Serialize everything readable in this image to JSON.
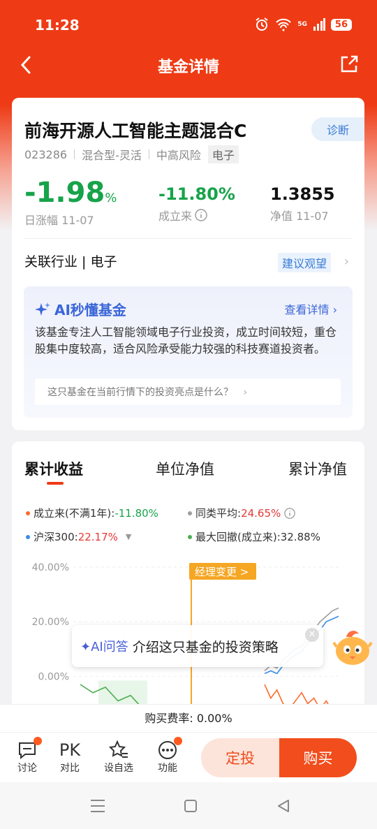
{
  "status": {
    "time": "11:28",
    "network": "5G",
    "battery": "56"
  },
  "nav": {
    "title": "基金详情"
  },
  "fund": {
    "name": "前海开源人工智能主题混合C",
    "diagnose": "诊断",
    "code": "023286",
    "type": "混合型-灵活",
    "risk": "中高风险",
    "sector_tag": "电子",
    "daily_change": "-1.98",
    "daily_change_unit": "%",
    "daily_label": "日涨幅 11-07",
    "since_inception": "-11.80%",
    "since_label": "成立来",
    "nav_value": "1.3855",
    "nav_label": "净值 11-07",
    "industry": "关联行业 | 电子",
    "suggestion": "建议观望"
  },
  "ai": {
    "title": "AI秒懂基金",
    "more": "查看详情 ›",
    "text": "该基金专注人工智能领域电子行业投资，成立时间较短，重仓股集中度较高，适合风险承受能力较强的科技赛道投资者。",
    "question": "这只基金在当前行情下的投资亮点是什么？"
  },
  "tabs": [
    "累计收益",
    "单位净值",
    "累计净值"
  ],
  "legend": {
    "l1_label": "成立来(不满1年):",
    "l1_value": "-11.80%",
    "l2_label": "同类平均:",
    "l2_value": "24.65%",
    "l3_label": "沪深300:",
    "l3_value": "22.17%",
    "l4_label": "最大回撤(成立来):",
    "l4_value": "32.88%"
  },
  "chart_data": {
    "type": "line",
    "y_ticks": [
      "40.00%",
      "20.00%",
      "0.00%"
    ],
    "ylim": [
      -15,
      40
    ],
    "marker_label": "经理变更 >",
    "series": [
      {
        "name": "同类平均",
        "color": "#9e9e9e",
        "values": [
          2,
          4,
          3,
          6,
          8,
          10,
          11,
          14,
          17,
          20,
          22,
          24,
          25
        ]
      },
      {
        "name": "沪深300",
        "color": "#3a8ee6",
        "values": [
          1,
          2,
          1,
          4,
          6,
          8,
          9,
          12,
          15,
          17,
          20,
          21,
          22
        ]
      },
      {
        "name": "成立来",
        "color": "#ff6a2b",
        "values": [
          -3,
          -8,
          -5,
          -10,
          -12,
          -9,
          -6,
          -10,
          -8,
          -12,
          -9,
          -13,
          -12
        ]
      }
    ]
  },
  "float_prompt": {
    "label": "✦AI问答",
    "text": "介绍这只基金的投资策略"
  },
  "fee": "购买费率: 0.00%",
  "toolbar": {
    "discuss": "讨论",
    "compare_icon": "PK",
    "compare": "对比",
    "watch": "设自选",
    "func": "功能",
    "sip": "定投",
    "buy": "购买"
  },
  "colors": {
    "brand": "#ee3b15",
    "down": "#17a34a",
    "up": "#e53935",
    "link": "#3a7bd5"
  }
}
